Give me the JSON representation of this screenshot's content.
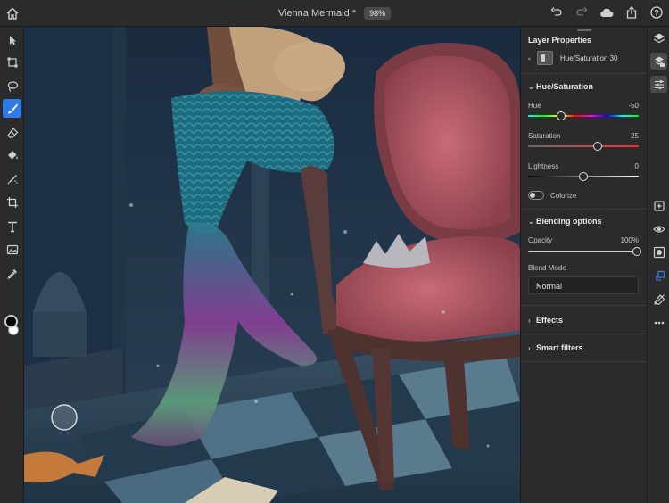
{
  "app": {
    "document_title": "Vienna Mermaid *",
    "zoom": "98%"
  },
  "icons": {
    "home": "home-icon",
    "undo": "undo-icon",
    "redo": "redo-icon",
    "cloud": "cloud-icon",
    "share": "share-icon",
    "help": "help-icon"
  },
  "tools": [
    {
      "name": "select-tool"
    },
    {
      "name": "transform-tool"
    },
    {
      "name": "lasso-tool"
    },
    {
      "name": "brush-tool",
      "active": true
    },
    {
      "name": "eraser-tool"
    },
    {
      "name": "fill-tool"
    },
    {
      "name": "healing-tool"
    },
    {
      "name": "crop-tool"
    },
    {
      "name": "type-tool"
    },
    {
      "name": "image-tool"
    },
    {
      "name": "eyedropper-tool"
    }
  ],
  "colors": {
    "accent": "#2f7ae5",
    "foreground_swatch": "#000000",
    "background_swatch": "#ffffff"
  },
  "panel": {
    "title": "Layer Properties",
    "layer_link": "⸗",
    "layer_name": "Hue/Saturation 30",
    "hue_saturation": {
      "header": "Hue/Saturation",
      "hue_label": "Hue",
      "hue_value": "-50",
      "hue_position": 0.3,
      "saturation_label": "Saturation",
      "saturation_value": "25",
      "saturation_position": 0.625,
      "lightness_label": "Lightness",
      "lightness_value": "0",
      "lightness_position": 0.5,
      "colorize_label": "Colorize"
    },
    "blending": {
      "header": "Blending options",
      "opacity_label": "Opacity",
      "opacity_value": "100%",
      "opacity_position": 1.0,
      "blend_mode_label": "Blend Mode",
      "blend_mode_value": "Normal"
    },
    "effects": {
      "header": "Effects"
    },
    "smart_filters": {
      "header": "Smart filters"
    }
  }
}
